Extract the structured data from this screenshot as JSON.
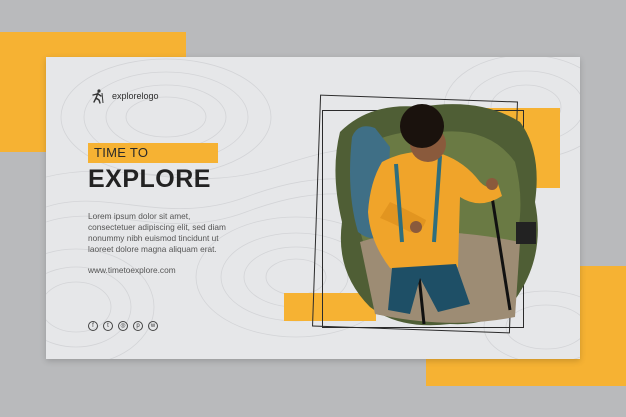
{
  "brand": {
    "logo_text": "explorelogo",
    "logo_icon": "hiker-icon"
  },
  "hero": {
    "tag": "TIME TO",
    "headline": "EXPLORE",
    "body_lines": [
      "Lorem ipsum dolor sit amet,",
      "consectetuer adipiscing elit, sed diam",
      "nonummy nibh euismod tincidunt ut",
      "laoreet dolore magna aliquam erat."
    ],
    "url": "www.timetoexplore.com"
  },
  "socials": [
    {
      "icon": "facebook-icon",
      "glyph": "f"
    },
    {
      "icon": "twitter-icon",
      "glyph": "t"
    },
    {
      "icon": "instagram-icon",
      "glyph": "◎"
    },
    {
      "icon": "pinterest-icon",
      "glyph": "p"
    },
    {
      "icon": "whatsapp-icon",
      "glyph": "w"
    }
  ],
  "colors": {
    "accent": "#f6b233",
    "dark": "#222222",
    "card": "#e6e7e9",
    "background": "#b9babc"
  }
}
